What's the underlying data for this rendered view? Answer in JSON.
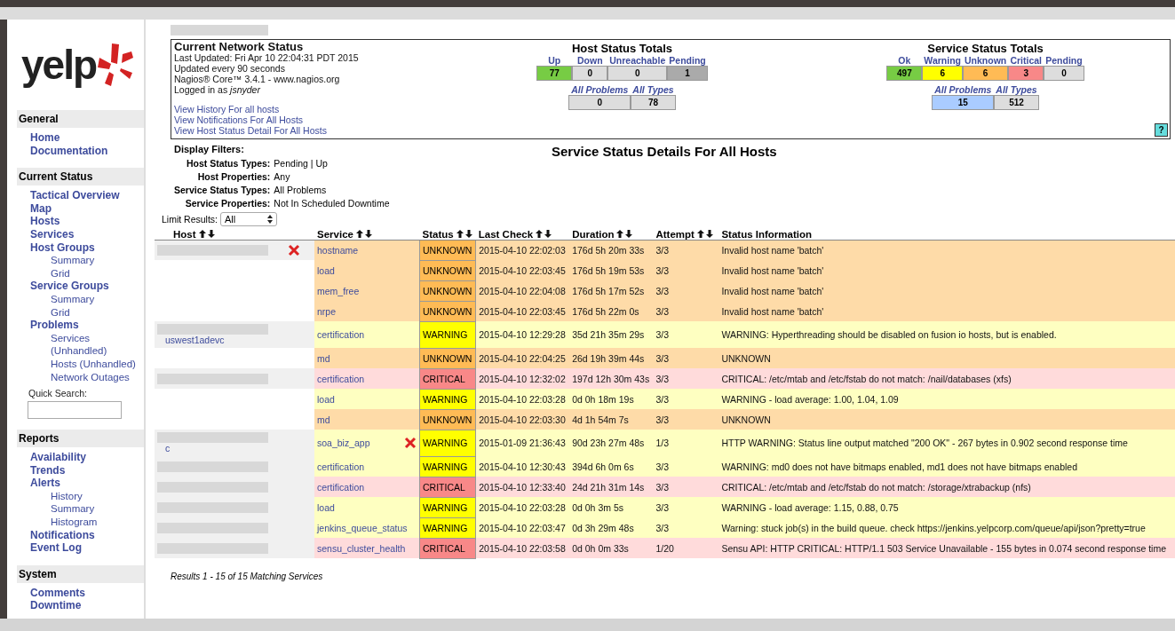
{
  "sidebar": {
    "logo": "yelp",
    "sections": [
      {
        "title": "General",
        "items": [
          {
            "label": "Home"
          },
          {
            "label": "Documentation"
          }
        ]
      },
      {
        "title": "Current Status",
        "items": [
          {
            "label": "Tactical Overview"
          },
          {
            "label": "Map"
          },
          {
            "label": "Hosts"
          },
          {
            "label": "Services"
          },
          {
            "label": "Host Groups",
            "children": [
              {
                "label": "Summary"
              },
              {
                "label": "Grid"
              }
            ]
          },
          {
            "label": "Service Groups",
            "children": [
              {
                "label": "Summary"
              },
              {
                "label": "Grid"
              }
            ]
          },
          {
            "label": "Problems",
            "children": [
              {
                "label": "Services (Unhandled)"
              },
              {
                "label": "Hosts (Unhandled)"
              },
              {
                "label": "Network Outages"
              }
            ]
          }
        ],
        "quick_search": {
          "label": "Quick Search:"
        }
      },
      {
        "title": "Reports",
        "items": [
          {
            "label": "Availability"
          },
          {
            "label": "Trends"
          },
          {
            "label": "Alerts",
            "children": [
              {
                "label": "History"
              },
              {
                "label": "Summary"
              },
              {
                "label": "Histogram"
              }
            ]
          },
          {
            "label": "Notifications"
          },
          {
            "label": "Event Log"
          }
        ]
      },
      {
        "title": "System",
        "items": [
          {
            "label": "Comments"
          },
          {
            "label": "Downtime"
          }
        ]
      }
    ]
  },
  "network_status": {
    "title": "Current Network Status",
    "lines": [
      "Last Updated: Fri Apr 10 22:04:31 PDT 2015",
      "Updated every 90 seconds",
      "Nagios® Core™ 3.4.1 - www.nagios.org",
      "Logged in as *jsnyder*"
    ],
    "links": [
      "View History For all hosts",
      "View Notifications For All Hosts",
      "View Host Status Detail For All Hosts"
    ]
  },
  "host_totals": {
    "title": "Host Status Totals",
    "states": [
      {
        "label": "Up",
        "count": "77",
        "color": "#77cc44"
      },
      {
        "label": "Down",
        "count": "0",
        "color": "#dddddd"
      },
      {
        "label": "Unreachable",
        "count": "0",
        "color": "#dddddd"
      },
      {
        "label": "Pending",
        "count": "1",
        "color": "#aaaaaa"
      }
    ],
    "summary": [
      {
        "label": "All Problems",
        "count": "0",
        "color": "#dddddd"
      },
      {
        "label": "All Types",
        "count": "78",
        "color": "#dddddd"
      }
    ]
  },
  "service_totals": {
    "title": "Service Status Totals",
    "states": [
      {
        "label": "Ok",
        "count": "497",
        "color": "#77cc44"
      },
      {
        "label": "Warning",
        "count": "6",
        "color": "#ffff00"
      },
      {
        "label": "Unknown",
        "count": "6",
        "color": "#ffbb55"
      },
      {
        "label": "Critical",
        "count": "3",
        "color": "#f88888"
      },
      {
        "label": "Pending",
        "count": "0",
        "color": "#dddddd"
      }
    ],
    "summary": [
      {
        "label": "All Problems",
        "count": "15",
        "color": "#aaccff"
      },
      {
        "label": "All Types",
        "count": "512",
        "color": "#dddddd"
      }
    ]
  },
  "help_label": "?",
  "filters": {
    "title": "Display Filters:",
    "items": [
      {
        "label": "Host Status Types:",
        "value": "Pending | Up"
      },
      {
        "label": "Host Properties:",
        "value": "Any"
      },
      {
        "label": "Service Status Types:",
        "value": "All Problems"
      },
      {
        "label": "Service Properties:",
        "value": "Not In Scheduled Downtime"
      }
    ]
  },
  "page_title": "Service Status Details For All Hosts",
  "limit": {
    "label": "Limit Results:",
    "value": "All"
  },
  "table": {
    "columns": [
      {
        "label": "Host",
        "sortable": true
      },
      {
        "label": "Service",
        "sortable": true
      },
      {
        "label": "Status",
        "sortable": true
      },
      {
        "label": "Last Check",
        "sortable": true
      },
      {
        "label": "Duration",
        "sortable": true
      },
      {
        "label": "Attempt",
        "sortable": true
      },
      {
        "label": "Status Information",
        "sortable": false
      }
    ],
    "rows": [
      {
        "host_hidden": true,
        "host": "",
        "host_down": true,
        "service": "hostname",
        "service_flag": false,
        "kind": "unknown",
        "status": "UNKNOWN",
        "last_check": "2015-04-10 22:02:03",
        "duration": "176d 5h 20m 33s",
        "attempt": "3/3",
        "info": "Invalid host name 'batch'"
      },
      {
        "host_hidden": false,
        "host": "",
        "host_down": false,
        "service": "load",
        "service_flag": false,
        "kind": "unknown",
        "status": "UNKNOWN",
        "last_check": "2015-04-10 22:03:45",
        "duration": "176d 5h 19m 53s",
        "attempt": "3/3",
        "info": "Invalid host name 'batch'"
      },
      {
        "host_hidden": false,
        "host": "",
        "host_down": false,
        "service": "mem_free",
        "service_flag": false,
        "kind": "unknown",
        "status": "UNKNOWN",
        "last_check": "2015-04-10 22:04:08",
        "duration": "176d 5h 17m 52s",
        "attempt": "3/3",
        "info": "Invalid host name 'batch'"
      },
      {
        "host_hidden": false,
        "host": "",
        "host_down": false,
        "service": "nrpe",
        "service_flag": false,
        "kind": "unknown",
        "status": "UNKNOWN",
        "last_check": "2015-04-10 22:03:45",
        "duration": "176d 5h 22m 0s",
        "attempt": "3/3",
        "info": "Invalid host name 'batch'"
      },
      {
        "host_hidden": true,
        "host": "uswest1adevc",
        "host_down": false,
        "service": "certification",
        "service_flag": false,
        "kind": "warning",
        "status": "WARNING",
        "last_check": "2015-04-10 12:29:28",
        "duration": "35d 21h 35m 29s",
        "attempt": "3/3",
        "info": "WARNING: Hyperthreading should be disabled on fusion io hosts, but is enabled."
      },
      {
        "host_hidden": false,
        "host": "",
        "host_down": false,
        "service": "md",
        "service_flag": false,
        "kind": "unknown",
        "status": "UNKNOWN",
        "last_check": "2015-04-10 22:04:25",
        "duration": "26d 19h 39m 44s",
        "attempt": "3/3",
        "info": "UNKNOWN"
      },
      {
        "host_hidden": true,
        "host": "",
        "host_down": false,
        "service": "certification",
        "service_flag": false,
        "kind": "critical",
        "status": "CRITICAL",
        "last_check": "2015-04-10 12:32:02",
        "duration": "197d 12h 30m 43s",
        "attempt": "3/3",
        "info": "CRITICAL: /etc/mtab and /etc/fstab do not match: /nail/databases (xfs)"
      },
      {
        "host_hidden": false,
        "host": "",
        "host_down": false,
        "service": "load",
        "service_flag": false,
        "kind": "warning",
        "status": "WARNING",
        "last_check": "2015-04-10 22:03:28",
        "duration": "0d 0h 18m 19s",
        "attempt": "3/3",
        "info": "WARNING - load average: 1.00, 1.04, 1.09"
      },
      {
        "host_hidden": false,
        "host": "",
        "host_down": false,
        "service": "md",
        "service_flag": false,
        "kind": "unknown",
        "status": "UNKNOWN",
        "last_check": "2015-04-10 22:03:30",
        "duration": "4d 1h 54m 7s",
        "attempt": "3/3",
        "info": "UNKNOWN"
      },
      {
        "host_hidden": true,
        "host": "c",
        "host_down": false,
        "service": "soa_biz_app",
        "service_flag": true,
        "kind": "warning",
        "status": "WARNING",
        "last_check": "2015-01-09 21:36:43",
        "duration": "90d 23h 27m 48s",
        "attempt": "1/3",
        "info": "HTTP WARNING: Status line output matched \"200 OK\" - 267 bytes in 0.902 second response time"
      },
      {
        "host_hidden": true,
        "host": "",
        "host_down": false,
        "service": "certification",
        "service_flag": false,
        "kind": "warning",
        "status": "WARNING",
        "last_check": "2015-04-10 12:30:43",
        "duration": "394d 6h 0m 6s",
        "attempt": "3/3",
        "info": "WARNING: md0 does not have bitmaps enabled, md1 does not have bitmaps enabled"
      },
      {
        "host_hidden": true,
        "host": "",
        "host_down": false,
        "service": "certification",
        "service_flag": false,
        "kind": "critical",
        "status": "CRITICAL",
        "last_check": "2015-04-10 12:33:40",
        "duration": "24d 21h 31m 14s",
        "attempt": "3/3",
        "info": "CRITICAL: /etc/mtab and /etc/fstab do not match: /storage/xtrabackup (nfs)"
      },
      {
        "host_hidden": true,
        "host": "",
        "host_down": false,
        "service": "load",
        "service_flag": false,
        "kind": "warning",
        "status": "WARNING",
        "last_check": "2015-04-10 22:03:28",
        "duration": "0d 0h 3m 5s",
        "attempt": "3/3",
        "info": "WARNING - load average: 1.15, 0.88, 0.75"
      },
      {
        "host_hidden": true,
        "host": "",
        "host_down": false,
        "service": "jenkins_queue_status",
        "service_flag": false,
        "kind": "warning",
        "status": "WARNING",
        "last_check": "2015-04-10 22:03:47",
        "duration": "0d 3h 29m 48s",
        "attempt": "3/3",
        "info": "Warning: stuck job(s) in the build queue. check https://jenkins.yelpcorp.com/queue/api/json?pretty=true"
      },
      {
        "host_hidden": true,
        "host": "",
        "host_down": false,
        "service": "sensu_cluster_health",
        "service_flag": false,
        "kind": "critical",
        "status": "CRITICAL",
        "last_check": "2015-04-10 22:03:58",
        "duration": "0d 0h 0m 33s",
        "attempt": "1/20",
        "info": "Sensu API: HTTP CRITICAL: HTTP/1.1 503 Service Unavailable - 155 bytes in 0.074 second response time"
      }
    ]
  },
  "results": "Results 1 - 15 of 15 Matching Services"
}
